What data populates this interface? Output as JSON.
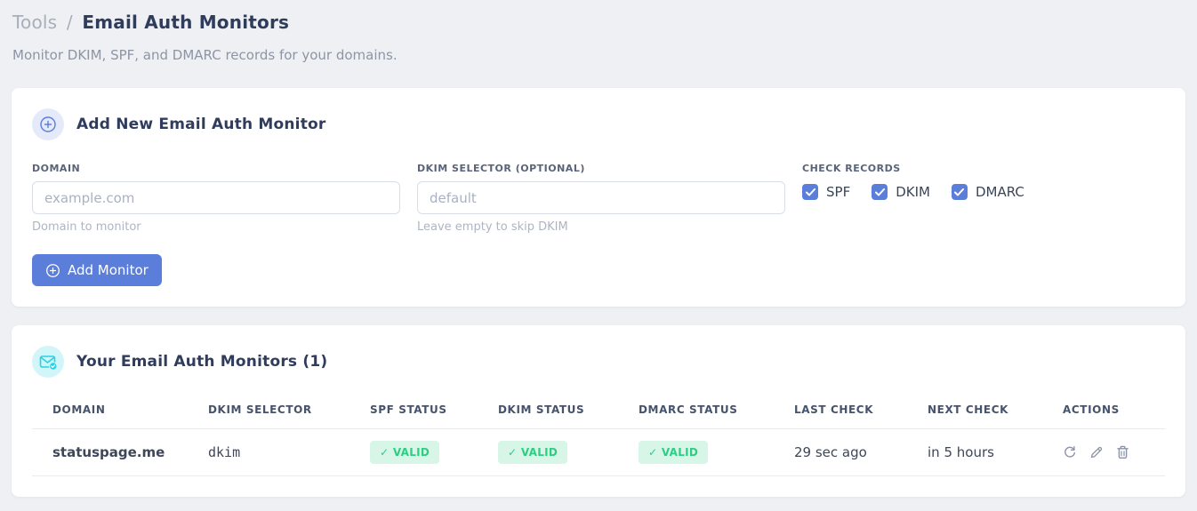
{
  "page": {
    "breadcrumb": {
      "parent": "Tools",
      "separator": "/",
      "current": "Email Auth Monitors"
    },
    "subtitle": "Monitor DKIM, SPF, and DMARC records for your domains."
  },
  "add_card": {
    "title": "Add New Email Auth Monitor",
    "domain": {
      "label": "DOMAIN",
      "value": "",
      "placeholder": "example.com",
      "helper": "Domain to monitor"
    },
    "dkim": {
      "label": "DKIM SELECTOR (OPTIONAL)",
      "value": "",
      "placeholder": "default",
      "helper": "Leave empty to skip DKIM"
    },
    "check_records": {
      "label": "CHECK RECORDS",
      "options": [
        {
          "label": "SPF",
          "checked": true
        },
        {
          "label": "DKIM",
          "checked": true
        },
        {
          "label": "DMARC",
          "checked": true
        }
      ]
    },
    "submit_label": "Add Monitor"
  },
  "list_card": {
    "title": "Your Email Auth Monitors (1)",
    "table": {
      "headers": [
        "DOMAIN",
        "DKIM SELECTOR",
        "SPF STATUS",
        "DKIM STATUS",
        "DMARC STATUS",
        "LAST CHECK",
        "NEXT CHECK",
        "ACTIONS"
      ],
      "rows": [
        {
          "domain": "statuspage.me",
          "dkim_selector": "dkim",
          "spf_status": "✓ VALID",
          "dkim_status": "✓ VALID",
          "dmarc_status": "✓ VALID",
          "last_check": "29 sec ago",
          "next_check": "in 5 hours"
        }
      ]
    }
  },
  "colors": {
    "accent_blue": "#5b7edb",
    "accent_cyan": "#25d3e3",
    "badge_green_bg": "#d8f6e7",
    "badge_green_text": "#2ecd84",
    "code_pink": "#ed4e89",
    "page_bg": "#eef0f3"
  }
}
